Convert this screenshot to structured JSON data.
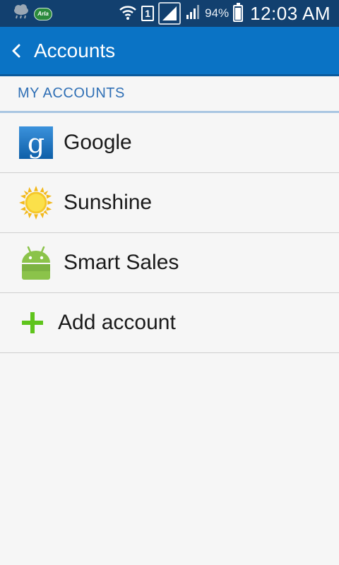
{
  "status_bar": {
    "battery_percent": "94%",
    "time": "12:03 AM",
    "sim_slot": "1",
    "app_logo_text": "Arla",
    "icons": [
      "weather-rain-icon",
      "arla-logo-icon",
      "wifi-icon",
      "sim-icon",
      "signal-icon",
      "signal-icon",
      "battery-icon"
    ],
    "battery_level": 0.94
  },
  "action_bar": {
    "title": "Accounts",
    "back_icon": "chevron-left-icon",
    "background_color": "#0a73c5"
  },
  "section": {
    "header": "MY ACCOUNTS",
    "header_color": "#2f6fb5"
  },
  "accounts": [
    {
      "label": "Google",
      "icon": "google-icon"
    },
    {
      "label": "Sunshine",
      "icon": "sun-icon"
    },
    {
      "label": "Smart Sales",
      "icon": "android-icon"
    }
  ],
  "add_account": {
    "label": "Add account",
    "icon": "plus-icon",
    "icon_color": "#5fc41c"
  }
}
